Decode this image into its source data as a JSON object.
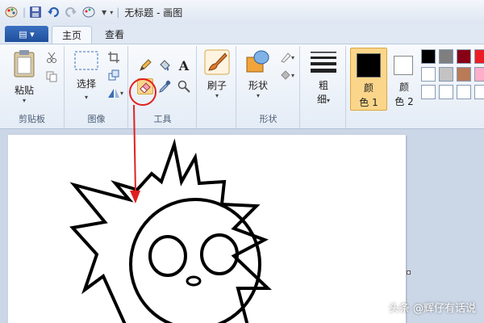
{
  "window": {
    "title": "无标题 - 画图"
  },
  "tabs": [
    {
      "label": "主页",
      "active": true
    },
    {
      "label": "查看",
      "active": false
    }
  ],
  "groups": {
    "clipboard": {
      "label": "剪贴板",
      "paste_label": "粘贴"
    },
    "image": {
      "label": "图像",
      "select_label": "选择"
    },
    "tools": {
      "label": "工具"
    },
    "brush": {
      "label": "刷子"
    },
    "shapes": {
      "label": "形状",
      "shapes_label": "形状"
    },
    "size": {
      "label_line1": "粗",
      "label_line2": "细"
    },
    "color1": {
      "label_line1": "颜",
      "label_line2": "色 1",
      "value": "#000000"
    },
    "color2": {
      "label_line1": "颜",
      "label_line2": "色 2",
      "value": "#ffffff"
    }
  },
  "palette": [
    "#000000",
    "#7f7f7f",
    "#880015",
    "#ed1c24",
    "#ffffff",
    "#c3c3c3",
    "#b97a57",
    "#ffaec9",
    "#ffffff",
    "#ffffff",
    "#ffffff",
    "#ffffff"
  ],
  "colors": {
    "highlight": "#e02020",
    "selected_bg": "#fbd68a"
  },
  "watermark": "头条 @辉仔有话说"
}
